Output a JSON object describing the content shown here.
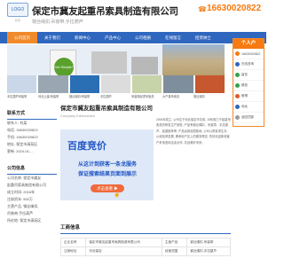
{
  "header": {
    "logo_text": "LOGO",
    "logo_caption": "标志",
    "company_name": "保定市冀友起重吊索具制造有限公司",
    "subtitle": "钢丝绳扣,吊装带,手拉葫芦",
    "phone_icon": "phone-icon",
    "phone": "16630020822"
  },
  "nav": [
    "公司首页",
    "关于我们",
    "新闻中心",
    "产品中心",
    "公司相册",
    "在线留言",
    "招贤纳士"
  ],
  "banner": {
    "bag_text": "Got Simple?"
  },
  "thumb_colors": [
    "#c9d7e8",
    "#9aa7b3",
    "#2a6fb4",
    "#dcdcdc",
    "#c7d3a8",
    "#7f8e9c",
    "#c6572e"
  ],
  "captions": [
    "手拉葫芦吊装带",
    "河北土建/吊装带",
    "钢丝绳扣/吊装带",
    "手拉葫芦",
    "吊装带起重吊索具",
    "大产量吊索具",
    "钢丝绳扣"
  ],
  "sidebar": {
    "contact_heading": "联系方式",
    "contact_lines": [
      "联系人: 刘某",
      "电话: 16630020822",
      "手机: 16630020822",
      "地址: 保定市清苑区",
      "更新: 2024-01-..."
    ],
    "company_heading": "公司信息",
    "company_lines": [
      "公司名称: 保定市冀友",
      "起重吊索具制造有限公司",
      "成立时间: 2016年",
      "注册资本: 500万",
      "主营产品: 钢丝绳扣,",
      "吊装带,手拉葫芦",
      "所在地: 保定市清苑区"
    ]
  },
  "main": {
    "title": "保定市冀友起重吊索具制造有限公司",
    "subtitle": "Company Introduction",
    "ad_logo": "百度竞价",
    "ad_line1": "从这计到获客一条龙服务",
    "ad_line2": "保证搜索结果页面到展示",
    "ad_button": "点击查看 ▶",
    "ad_hand": "☝",
    "intro": "2006年成立, 公司位于河北保定市清苑, 18年致力于起重吊索具的研发生产销售, 产品有钢丝绳扣、吊装带、手拉葫芦、起重链条等, 产品远销全国各地, 公司以质量求生存, 以诚信求发展, 秉承用户至上的服务理念, 热情欢迎新老客户来电咨询洽谈合作, 共创美好未来。"
  },
  "business": {
    "heading": "工商信息",
    "rows": [
      [
        "企业名称",
        "保定市冀友起重吊索具制造有限公司",
        "主营产品",
        "钢丝绳扣,吊装带"
      ],
      [
        "注册地址",
        "河北保定",
        "经营范围",
        "钢丝绳扣,手拉葫芦"
      ]
    ]
  },
  "panel": {
    "heading": "个人户",
    "items": [
      {
        "icon": "phone-icon",
        "label": "16630020822",
        "color": "#f57b12"
      },
      {
        "icon": "chat-icon",
        "label": "在线咨询",
        "color": "#2f67bf"
      },
      {
        "icon": "message-icon",
        "label": "留言",
        "color": "#36a34a"
      },
      {
        "icon": "wechat-icon",
        "label": "微信",
        "color": "#36a34a"
      },
      {
        "icon": "weibo-icon",
        "label": "微博",
        "color": "#e05a2b"
      },
      {
        "icon": "map-icon",
        "label": "地址",
        "color": "#2f67bf"
      },
      {
        "icon": "top-icon",
        "label": "返回顶部",
        "color": "#999999"
      }
    ]
  }
}
